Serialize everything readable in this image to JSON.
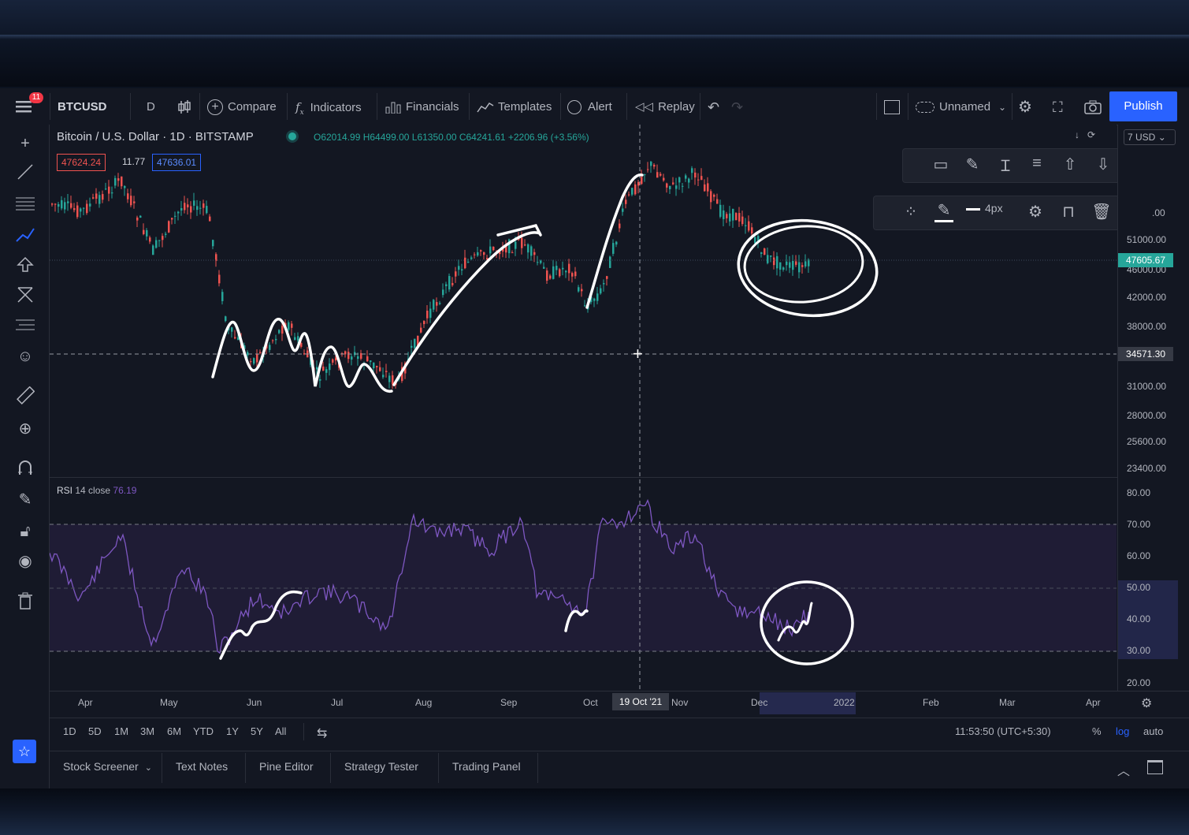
{
  "toolbar": {
    "symbol": "BTCUSD",
    "interval": "D",
    "compare_label": "Compare",
    "indicators_label": "Indicators",
    "financials_label": "Financials",
    "templates_label": "Templates",
    "alert_label": "Alert",
    "replay_label": "Replay",
    "layout_name": "Unnamed",
    "publish_label": "Publish",
    "menu_badge": "11"
  },
  "legend": {
    "title": "Bitcoin / U.S. Dollar · 1D · BITSTAMP",
    "ohlc": "O62014.99 H64499.00 L61350.00 C64241.61 +2206.96 (+3.56%)",
    "bid": "47624.24",
    "spread": "11.77",
    "ask": "47636.01"
  },
  "price_axis": {
    "currency": "USD",
    "labels": [
      "51000.00",
      "47605.67",
      "46000.00",
      "42000.00",
      "38000.00",
      "34571.30",
      "31000.00",
      "28000.00",
      "25600.00",
      "23400.00"
    ],
    "last_price": "47605.67",
    "crosshair_price": "34571.30",
    "partial_top": ".00"
  },
  "rsi": {
    "label": "RSI",
    "params": "14 close",
    "value": "76.19",
    "labels": [
      "80.00",
      "70.00",
      "60.00",
      "50.00",
      "40.00",
      "30.00",
      "20.00"
    ]
  },
  "time_axis": {
    "labels": [
      "Apr",
      "May",
      "Jun",
      "Jul",
      "Aug",
      "Sep",
      "Oct",
      "Nov",
      "Dec",
      "2022",
      "Feb",
      "Mar",
      "Apr"
    ],
    "crosshair_date": "19 Oct '21"
  },
  "drawing_toolbar": {
    "width_label": "4px"
  },
  "bottom": {
    "ranges": [
      "1D",
      "5D",
      "1M",
      "3M",
      "6M",
      "YTD",
      "1Y",
      "5Y",
      "All"
    ],
    "clock": "11:53:50 (UTC+5:30)",
    "percent_label": "%",
    "log_label": "log",
    "auto_label": "auto",
    "tabs": [
      "Stock Screener",
      "Text Notes",
      "Pine Editor",
      "Strategy Tester",
      "Trading Panel"
    ]
  },
  "colors": {
    "background": "#131722",
    "up": "#26a69a",
    "down": "#ef5350",
    "accent": "#2962ff",
    "last_price_bg": "#26a69a",
    "rsi_band": "#2a2245"
  }
}
